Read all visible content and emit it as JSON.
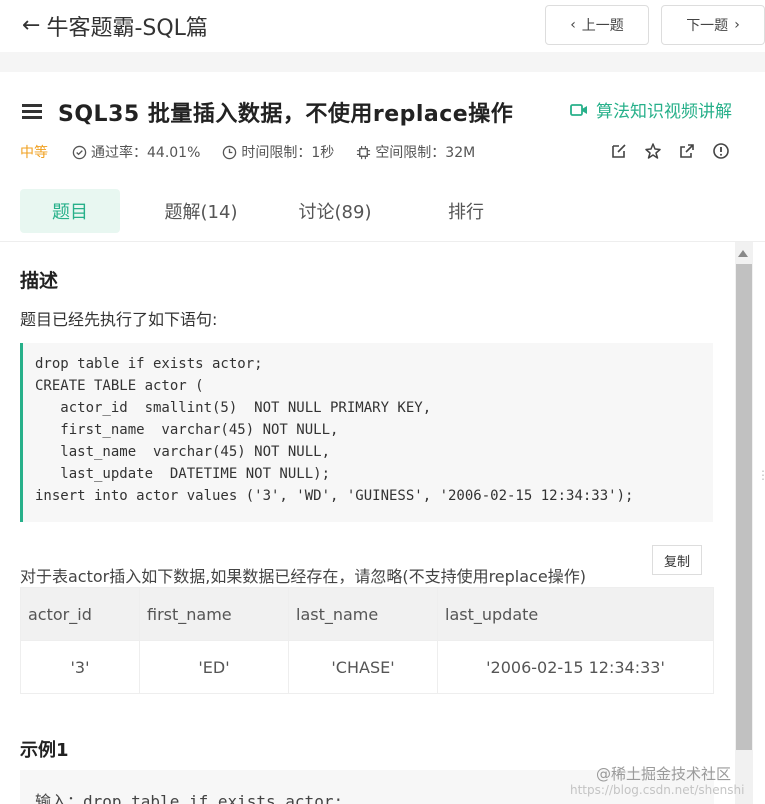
{
  "topbar": {
    "back_label": "牛客题霸-SQL篇",
    "prev_label": "上一题",
    "next_label": "下一题"
  },
  "problem": {
    "title": "SQL35  批量插入数据，不使用replace操作",
    "video_link": "算法知识视频讲解",
    "difficulty": "中等",
    "pass_rate": "通过率：44.01%",
    "time_limit": "时间限制：1秒",
    "space_limit": "空间限制：32M"
  },
  "tabs": [
    {
      "label": "题目"
    },
    {
      "label": "题解(14)"
    },
    {
      "label": "讨论(89)"
    },
    {
      "label": "排行"
    }
  ],
  "description": {
    "heading": "描述",
    "intro": "题目已经先执行了如下语句:",
    "code_lines": [
      "drop table if exists actor;",
      "CREATE TABLE actor (",
      "   actor_id  smallint(5)  NOT NULL PRIMARY KEY,",
      "   first_name  varchar(45) NOT NULL,",
      "   last_name  varchar(45) NOT NULL,",
      "   last_update  DATETIME NOT NULL);",
      "insert into actor values ('3', 'WD', 'GUINESS', '2006-02-15 12:34:33');"
    ],
    "task": "对于表actor插入如下数据,如果数据已经存在，请忽略(不支持使用replace操作)",
    "table": {
      "headers": [
        "actor_id",
        "first_name",
        "last_name",
        "last_update"
      ],
      "row": [
        "'3'",
        "'ED'",
        "'CHASE'",
        "'2006-02-15 12:34:33'"
      ]
    }
  },
  "example": {
    "heading": "示例1",
    "input": "输入：drop table if exists actor;",
    "copy_label": "复制"
  },
  "watermark": {
    "text": "@稀土掘金技术社区",
    "faint": "https://blog.csdn.net/shenshi"
  },
  "colors": {
    "accent": "#27b08a",
    "difficulty": "#f0a020"
  }
}
